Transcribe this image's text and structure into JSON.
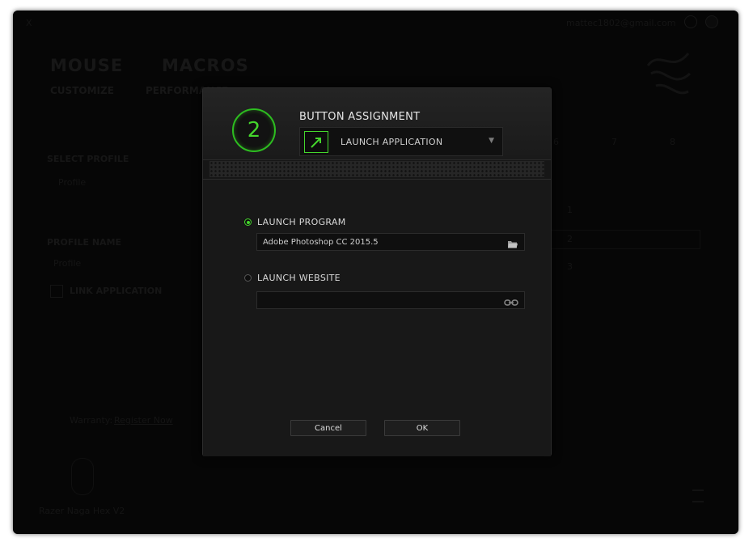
{
  "titlebar": {
    "close_label": "X",
    "account": "mattec1802@gmail.com"
  },
  "nav": {
    "main_tabs": [
      "MOUSE",
      "MACROS"
    ],
    "sub_tabs": [
      "CUSTOMIZE",
      "PERFORMANCE"
    ]
  },
  "profile_panel": {
    "select_label": "SELECT PROFILE",
    "profile_value": "Profile",
    "profile_name_label": "PROFILE NAME",
    "profile_name_value": "Profile",
    "link_app_label": "LINK APPLICATION",
    "warranty_label": "Warranty:",
    "register_link": "Register Now",
    "device_name": "Razer Naga Hex V2"
  },
  "background_buttons": {
    "top_numbers": [
      "6",
      "7",
      "8"
    ],
    "side_numbers": [
      "1",
      "2",
      "3"
    ]
  },
  "dialog": {
    "button_number": "2",
    "title": "BUTTON ASSIGNMENT",
    "assignment_value": "LAUNCH APPLICATION",
    "launch_program_label": "LAUNCH PROGRAM",
    "program_value": "Adobe Photoshop CC 2015.5",
    "launch_website_label": "LAUNCH WEBSITE",
    "website_value": "",
    "cancel_label": "Cancel",
    "ok_label": "OK"
  },
  "colors": {
    "accent": "#44d62c",
    "background": "#0b0b0b",
    "dialog": "#181818"
  },
  "icons": {
    "assignment": "launch-arrow-icon",
    "program_browse": "folder-icon",
    "website_link": "link-icon"
  }
}
